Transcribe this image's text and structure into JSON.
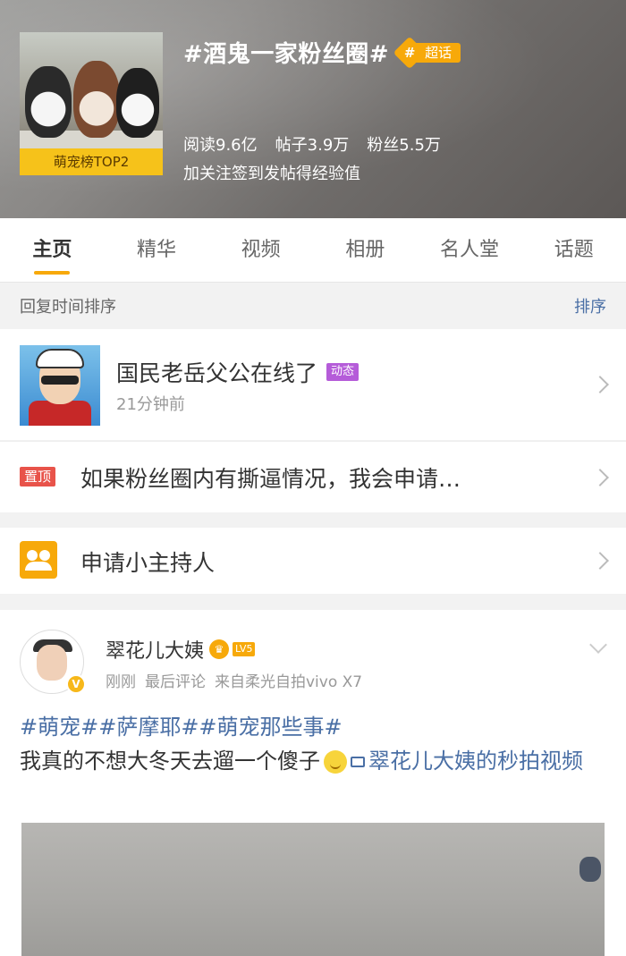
{
  "header": {
    "title": "#酒鬼一家粉丝圈#",
    "chaohua_badge": "超话",
    "cover_rank": "萌宠榜TOP2",
    "stats": {
      "reads": "阅读9.6亿",
      "posts": "帖子3.9万",
      "fans": "粉丝5.5万"
    },
    "subtitle": "加关注签到发帖得经验值"
  },
  "tabs": [
    "主页",
    "精华",
    "视频",
    "相册",
    "名人堂",
    "话题"
  ],
  "sortbar": {
    "label": "回复时间排序",
    "button": "排序"
  },
  "feature_post": {
    "title": "国民老岳父公在线了",
    "badge": "动态",
    "time": "21分钟前"
  },
  "pinned": {
    "badge": "置顶",
    "text": "如果粉丝圈内有撕逼情况，我会申请…"
  },
  "host": {
    "text": "申请小主持人"
  },
  "card": {
    "user": "翠花儿大姨",
    "level": "LV5",
    "meta": {
      "time": "刚刚",
      "action": "最后评论",
      "source": "来自柔光自拍vivo X7"
    },
    "hashtags": "#萌宠##萨摩耶##萌宠那些事#",
    "text": "我真的不想大冬天去遛一个傻子",
    "video_link": "翠花儿大姨的秒拍视频"
  },
  "colors": {
    "accent": "#f7a90a",
    "link": "#4a6fa5",
    "pin": "#e8534a",
    "dongtai": "#b55cd9"
  }
}
